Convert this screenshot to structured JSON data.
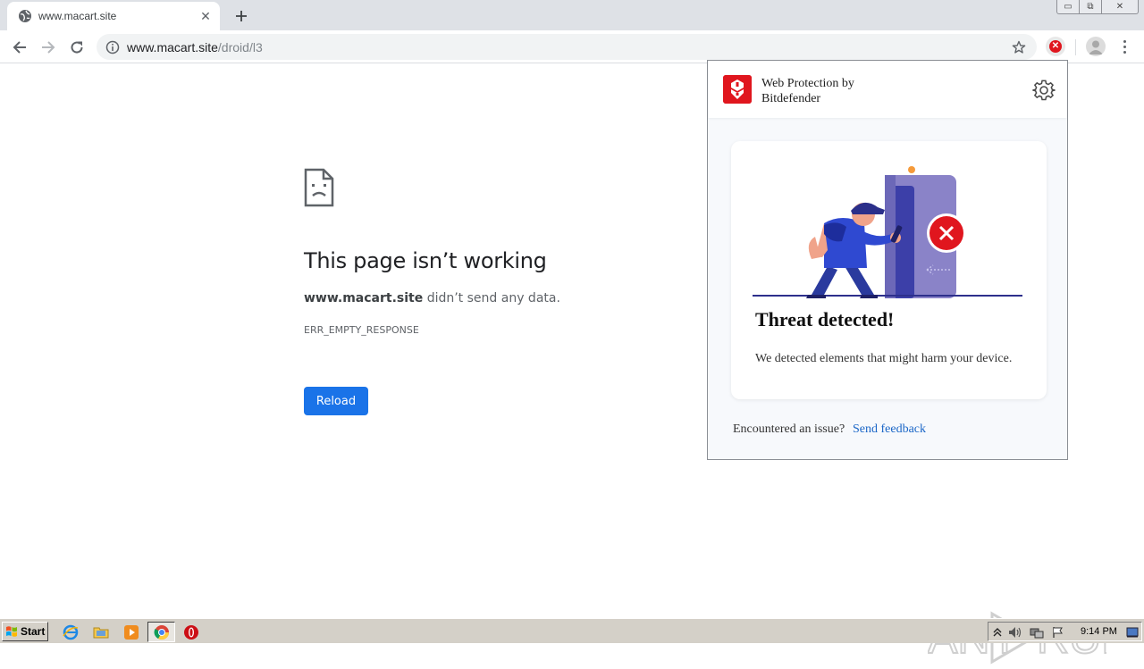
{
  "browser": {
    "tab": {
      "title": "www.macart.site",
      "close": "✕",
      "new_tab": "+"
    },
    "window_controls": {
      "minimize": "▭",
      "restore": "⧉",
      "close": "✕"
    },
    "omnibox": {
      "host": "www.macart.site",
      "path": "/droid/l3"
    }
  },
  "error_page": {
    "title": "This page isn’t working",
    "host": "www.macart.site",
    "message_suffix": " didn’t send any data.",
    "code": "ERR_EMPTY_RESPONSE",
    "reload_label": "Reload"
  },
  "extension_popup": {
    "header_title_line1": "Web Protection by",
    "header_title_line2": "Bitdefender",
    "card_title": "Threat detected!",
    "card_description": "We detected elements that might harm your device.",
    "footer_question": "Encountered an issue?",
    "footer_link": "Send feedback",
    "brand_color": "#e0161e",
    "link_color": "#1a66c7"
  },
  "watermark": {
    "text": "ANY RUN"
  },
  "taskbar": {
    "start_label": "Start",
    "clock": "9:14 PM"
  },
  "colors": {
    "accent_blue": "#1a73e8",
    "threat_red": "#e0161e",
    "taskbar": "#d4d0c8"
  }
}
